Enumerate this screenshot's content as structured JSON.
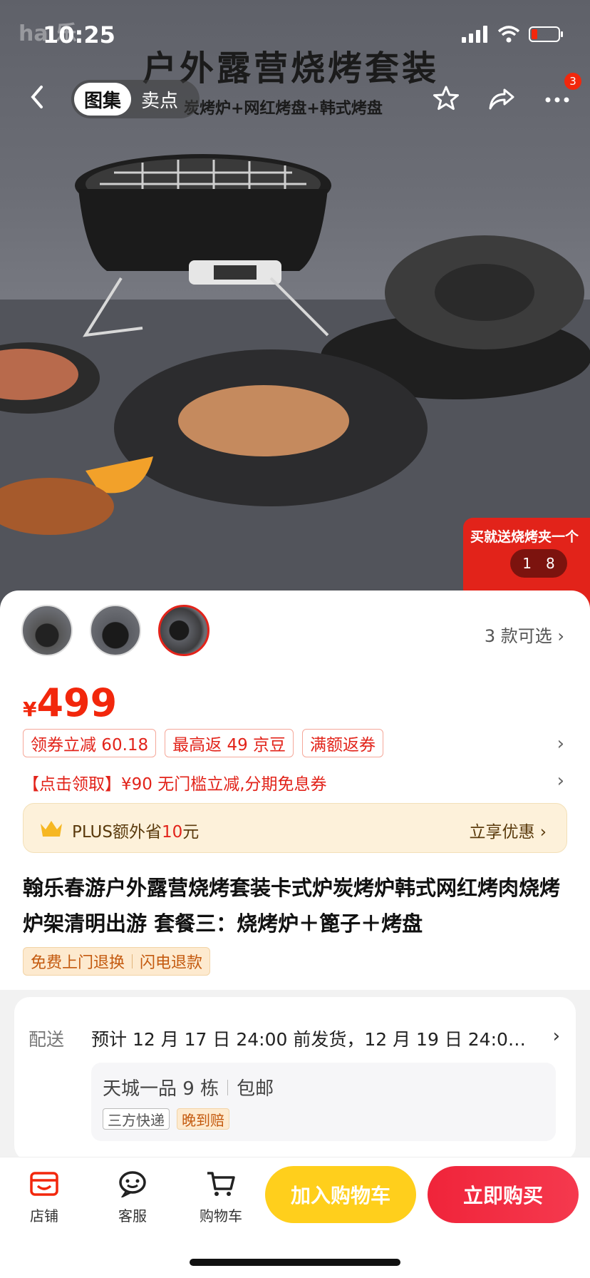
{
  "status": {
    "time": "10:25"
  },
  "hero": {
    "watermark": "ha   乐",
    "title": "户外露营烧烤套装",
    "subtitle": "炭烤炉+网红烤盘+韩式烤盘",
    "promo": "买就送烧烤夹一个",
    "counter_current": "1",
    "counter_total": "8"
  },
  "nav": {
    "tabs": [
      {
        "label": "图集",
        "active": true
      },
      {
        "label": "卖点",
        "active": false
      }
    ],
    "cart_badge": "3",
    "icons": [
      "back-icon",
      "star-icon",
      "share-icon",
      "more-icon"
    ]
  },
  "product": {
    "variants_label": "3 款可选 ›",
    "price_symbol": "¥",
    "price": "499",
    "coupons": [
      "领券立减 60.18",
      "最高返 49 京豆",
      "满额返券"
    ],
    "claim_text": "【点击领取】¥90 无门槛立减,分期免息券",
    "plus": {
      "prefix": "PLUS额外省",
      "amount": "10",
      "suffix": "元",
      "cta": "立享优惠 ›"
    },
    "title": "翰乐春游户外露营烧烤套装卡式炉炭烤炉韩式网红烤肉烧烤炉架清明出游 套餐三：烧烤炉＋篦子＋烤盘",
    "service_tags": [
      "免费上门退换",
      "闪电退款"
    ]
  },
  "delivery": {
    "label": "配送",
    "text": "预计 12 月 17 日 24:00 前发货，12 月 19 日 24:00 …",
    "address": "天城一品 9 栋",
    "shipping": "包邮",
    "chips": [
      "三方快递",
      "晚到赔"
    ]
  },
  "bottom": {
    "store": "店铺",
    "service": "客服",
    "cart": "购物车",
    "add_to_cart": "加入购物车",
    "buy_now": "立即购买"
  },
  "colors": {
    "accent": "#f2270c",
    "cart_button": "#ffcf1c",
    "buy_button": "#f0243a"
  }
}
